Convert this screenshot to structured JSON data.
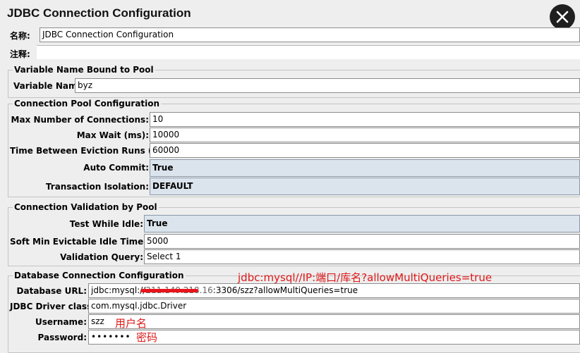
{
  "window": {
    "title": "JDBC Connection Configuration"
  },
  "header": {
    "name_label": "名称:",
    "name_value": "JDBC Connection Configuration",
    "comment_label": "注释:",
    "comment_value": ""
  },
  "variable_group": {
    "title": "Variable Name Bound to Pool",
    "var_label": "Variable Name:",
    "var_value": "byz"
  },
  "pool_group": {
    "title": "Connection Pool Configuration",
    "max_conn_label": "Max Number of Connections:",
    "max_conn_value": "10",
    "max_wait_label": "Max Wait (ms):",
    "max_wait_value": "10000",
    "eviction_label": "Time Between Eviction Runs (ms):",
    "eviction_value": "60000",
    "auto_commit_label": "Auto Commit:",
    "auto_commit_value": "True",
    "isolation_label": "Transaction Isolation:",
    "isolation_value": "DEFAULT"
  },
  "validation_group": {
    "title": "Connection Validation by Pool",
    "test_idle_label": "Test While Idle:",
    "test_idle_value": "True",
    "soft_min_label": "Soft Min Evictable Idle Time(ms):",
    "soft_min_value": "5000",
    "query_label": "Validation Query:",
    "query_value": "Select 1"
  },
  "db_group": {
    "title": "Database Connection Configuration",
    "url_label": "Database URL:",
    "url_prefix": "jdbc:mysql://",
    "url_redacted": "211.149.218.16",
    "url_suffix": ":3306/szz?allowMultiQueries=true",
    "driver_label": "JDBC Driver class:",
    "driver_value": "com.mysql.jdbc.Driver",
    "username_label": "Username:",
    "username_value": "szz",
    "password_label": "Password:",
    "password_value": "•••••••"
  },
  "annotations": {
    "url_format": "jdbc:mysql//IP:端口/库名?allowMultiQueries=true",
    "username_note": "用户名",
    "password_note": "密码"
  },
  "colors": {
    "annotation_red": "#e01818",
    "combo_bg": "#dbe3ec",
    "panel_bg": "#eeeeee"
  },
  "icons": {
    "close": "close-icon"
  }
}
